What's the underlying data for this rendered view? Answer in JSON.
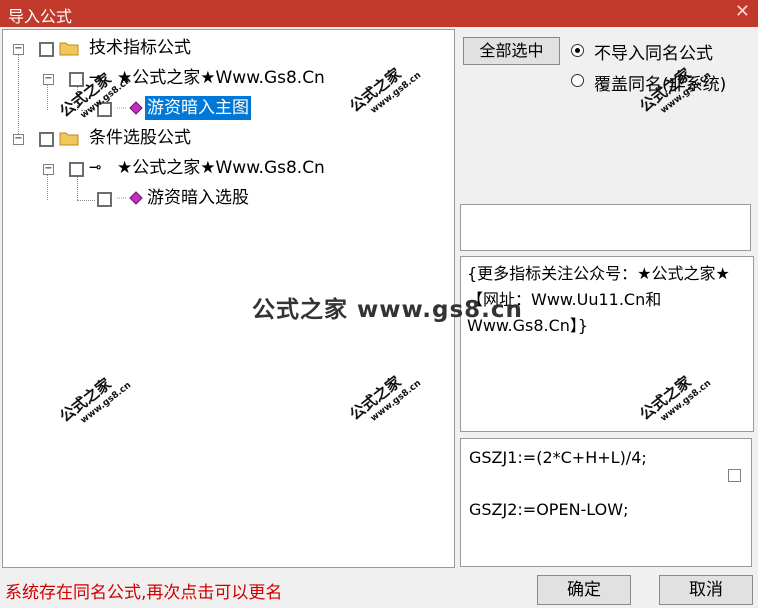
{
  "window": {
    "title": "导入公式",
    "close_glyph": "✕"
  },
  "tree": {
    "nodes": [
      {
        "label": "技术指标公式",
        "icon": "folder-icon"
      },
      {
        "label": "★公式之家★Www.Gs8.Cn",
        "icon": "key-icon"
      },
      {
        "label": "游资暗入主图",
        "icon": "gem-icon",
        "selected": true
      },
      {
        "label": "条件选股公式",
        "icon": "folder-icon"
      },
      {
        "label": "★公式之家★Www.Gs8.Cn",
        "icon": "key-icon"
      },
      {
        "label": "游资暗入选股",
        "icon": "gem-icon"
      }
    ],
    "expander_glyph": "−"
  },
  "options": {
    "select_all_label": "全部选中",
    "radio_no_import": "不导入同名公式",
    "radio_overwrite": "覆盖同名(非系统)",
    "selected_radio": "no_import"
  },
  "description": {
    "text": "{更多指标关注公众号：★公式之家★ 【网址：Www.Uu11.Cn和Www.Gs8.Cn】}"
  },
  "code": {
    "line1": "GSZJ1:=(2*C+H+L)/4;",
    "line2": "GSZJ2:=OPEN-LOW;"
  },
  "status": {
    "message": "系统存在同名公式,再次点击可以更名"
  },
  "buttons": {
    "ok": "确定",
    "cancel": "取消"
  },
  "watermark": {
    "cn": "公式之家",
    "en": "www.gs8.cn",
    "center": "公式之家 www.gs8.cn"
  },
  "colors": {
    "titlebar": "#c0392b",
    "selection": "#0078d7",
    "status_text": "#d00000",
    "gem": "#c030c0"
  }
}
